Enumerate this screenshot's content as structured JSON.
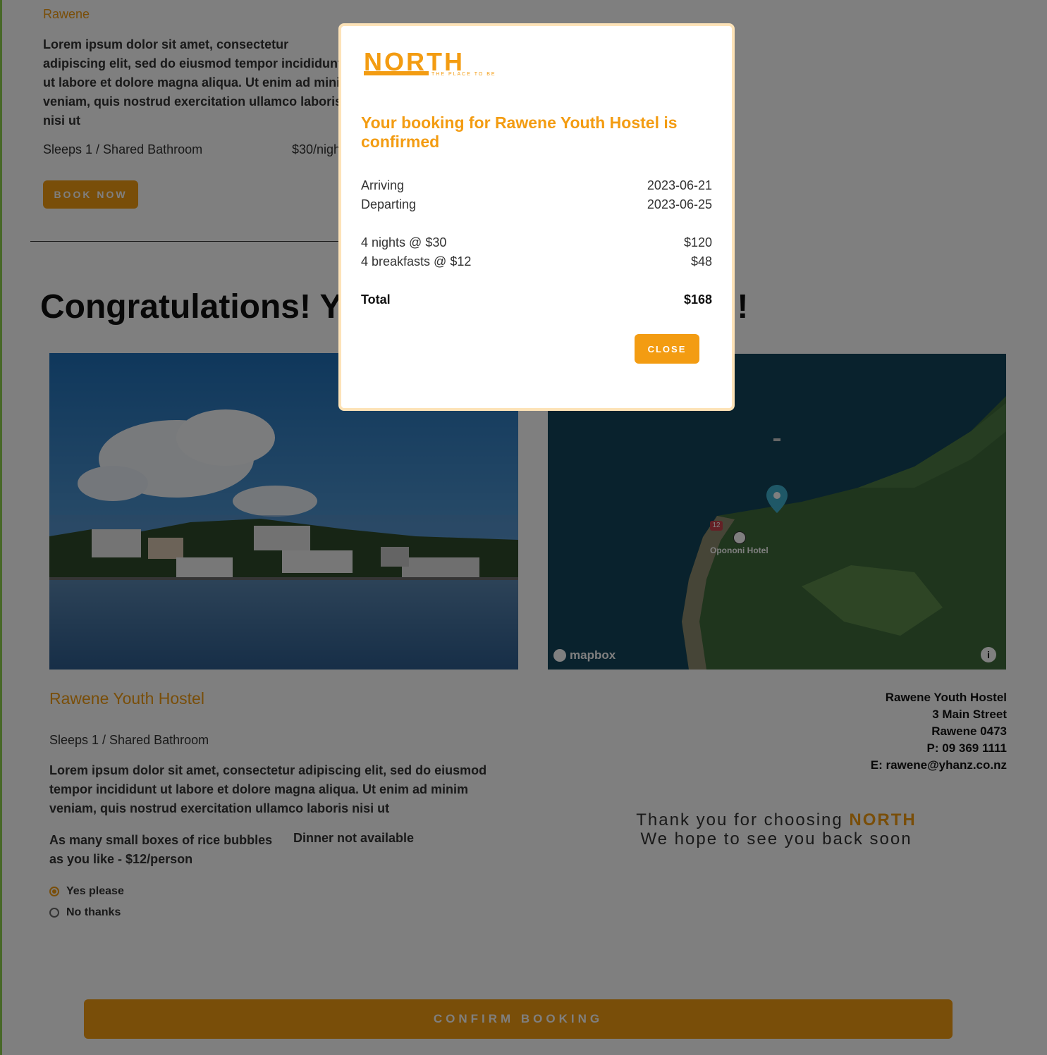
{
  "top_listing": {
    "name": "Rawene",
    "description": "Lorem ipsum dolor sit amet, consectetur adipiscing elit, sed do eiusmod tempor incididunt ut labore et dolore magna aliqua. Ut enim ad minim veniam, quis nostrud exercitation ullamco laboris nisi ut",
    "sleeps": "Sleeps 1 / Shared Bathroom",
    "price": "$30/nigh",
    "book_label": "BOOK NOW"
  },
  "congrats_heading": "Congratulations! You're staying in Rawene!!",
  "map": {
    "attribution": "mapbox",
    "place_label": "Opononi Hotel",
    "road_number": "12"
  },
  "hostel": {
    "name": "Rawene Youth Hostel",
    "sleeps": "Sleeps 1 / Shared Bathroom",
    "description": "Lorem ipsum dolor sit amet, consectetur adipiscing elit, sed do eiusmod tempor incididunt ut labore et dolore magna aliqua. Ut enim ad minim veniam, quis nostrud exercitation ullamco laboris nisi ut",
    "breakfast": "As many small boxes of rice bubbles as you like - $12/person",
    "dinner": "Dinner not available",
    "options": [
      "Yes please",
      "No thanks"
    ]
  },
  "address": {
    "name": "Rawene Youth Hostel",
    "street": "3 Main Street",
    "city": "Rawene 0473",
    "phone": "P: 09 369 1111",
    "email": "E: rawene@yhanz.co.nz"
  },
  "thanks": {
    "line1_prefix": "Thank you for choosing",
    "brand": "NORTH",
    "line2": "We hope to see you back soon"
  },
  "confirm_label": "CONFIRM BOOKING",
  "modal": {
    "logo_text": "NORTH",
    "logo_tagline": "THE PLACE TO BE",
    "title": "Your booking for Rawene Youth Hostel is confirmed",
    "arriving_label": "Arriving",
    "arriving_value": "2023-06-21",
    "departing_label": "Departing",
    "departing_value": "2023-06-25",
    "nights_label": "4 nights @ $30",
    "nights_value": "$120",
    "breakfasts_label": "4 breakfasts @ $12",
    "breakfasts_value": "$48",
    "total_label": "Total",
    "total_value": "$168",
    "close_label": "CLOSE"
  },
  "colors": {
    "accent": "#f39c12",
    "overlay": "rgba(0,0,0,0.5)"
  }
}
